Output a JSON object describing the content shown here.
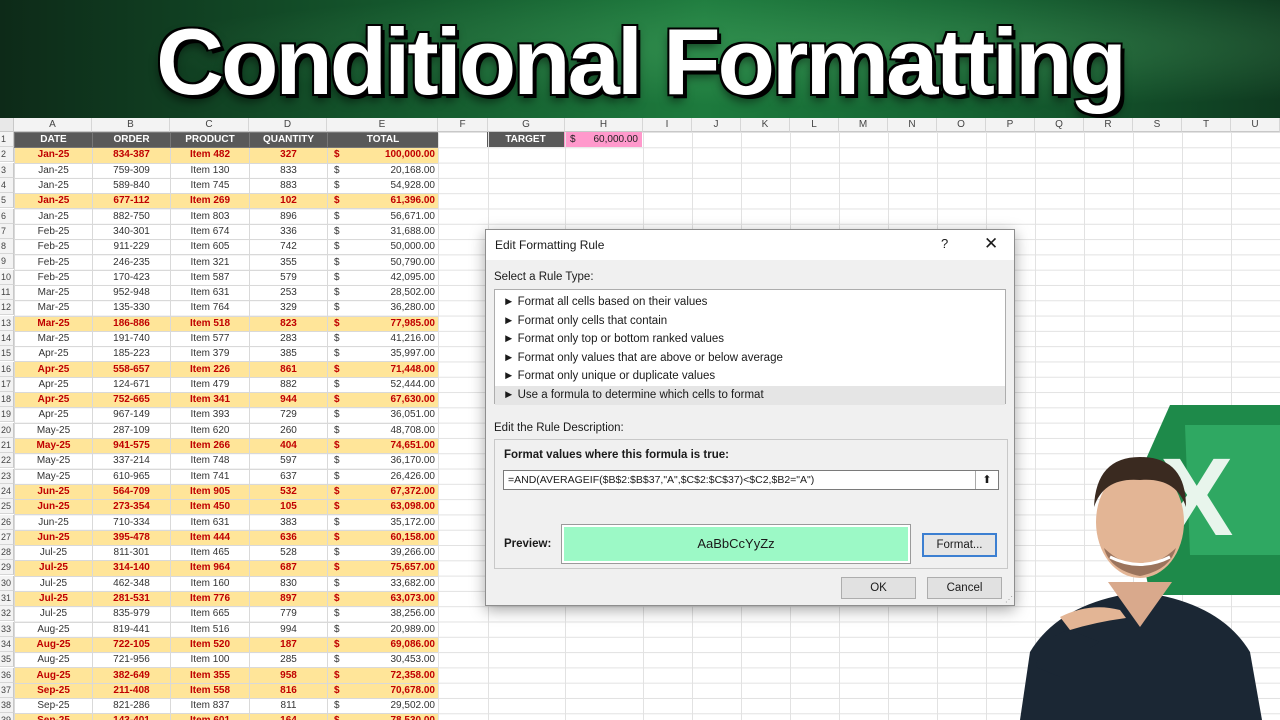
{
  "banner": {
    "title": "Conditional Formatting"
  },
  "columns": [
    "A",
    "B",
    "C",
    "D",
    "E",
    "F",
    "G",
    "H",
    "I",
    "J",
    "K",
    "L",
    "M",
    "N",
    "O",
    "P",
    "Q",
    "R",
    "S",
    "T",
    "U"
  ],
  "table": {
    "headers": [
      "DATE",
      "ORDER",
      "PRODUCT",
      "QUANTITY",
      "TOTAL"
    ],
    "currency": "$",
    "rows": [
      {
        "n": "2",
        "date": "Jan-25",
        "order": "834-387",
        "product": "Item 482",
        "qty": "327",
        "total": "100,000.00",
        "hl": true
      },
      {
        "n": "3",
        "date": "Jan-25",
        "order": "759-309",
        "product": "Item 130",
        "qty": "833",
        "total": "20,168.00",
        "hl": false
      },
      {
        "n": "4",
        "date": "Jan-25",
        "order": "589-840",
        "product": "Item 745",
        "qty": "883",
        "total": "54,928.00",
        "hl": false
      },
      {
        "n": "5",
        "date": "Jan-25",
        "order": "677-112",
        "product": "Item 269",
        "qty": "102",
        "total": "61,396.00",
        "hl": true
      },
      {
        "n": "6",
        "date": "Jan-25",
        "order": "882-750",
        "product": "Item 803",
        "qty": "896",
        "total": "56,671.00",
        "hl": false
      },
      {
        "n": "7",
        "date": "Feb-25",
        "order": "340-301",
        "product": "Item 674",
        "qty": "336",
        "total": "31,688.00",
        "hl": false
      },
      {
        "n": "8",
        "date": "Feb-25",
        "order": "911-229",
        "product": "Item 605",
        "qty": "742",
        "total": "50,000.00",
        "hl": false
      },
      {
        "n": "9",
        "date": "Feb-25",
        "order": "246-235",
        "product": "Item 321",
        "qty": "355",
        "total": "50,790.00",
        "hl": false
      },
      {
        "n": "10",
        "date": "Feb-25",
        "order": "170-423",
        "product": "Item 587",
        "qty": "579",
        "total": "42,095.00",
        "hl": false
      },
      {
        "n": "11",
        "date": "Mar-25",
        "order": "952-948",
        "product": "Item 631",
        "qty": "253",
        "total": "28,502.00",
        "hl": false
      },
      {
        "n": "12",
        "date": "Mar-25",
        "order": "135-330",
        "product": "Item 764",
        "qty": "329",
        "total": "36,280.00",
        "hl": false
      },
      {
        "n": "13",
        "date": "Mar-25",
        "order": "186-886",
        "product": "Item 518",
        "qty": "823",
        "total": "77,985.00",
        "hl": true
      },
      {
        "n": "14",
        "date": "Mar-25",
        "order": "191-740",
        "product": "Item 577",
        "qty": "283",
        "total": "41,216.00",
        "hl": false
      },
      {
        "n": "15",
        "date": "Apr-25",
        "order": "185-223",
        "product": "Item 379",
        "qty": "385",
        "total": "35,997.00",
        "hl": false
      },
      {
        "n": "16",
        "date": "Apr-25",
        "order": "558-657",
        "product": "Item 226",
        "qty": "861",
        "total": "71,448.00",
        "hl": true
      },
      {
        "n": "17",
        "date": "Apr-25",
        "order": "124-671",
        "product": "Item 479",
        "qty": "882",
        "total": "52,444.00",
        "hl": false
      },
      {
        "n": "18",
        "date": "Apr-25",
        "order": "752-665",
        "product": "Item 341",
        "qty": "944",
        "total": "67,630.00",
        "hl": true
      },
      {
        "n": "19",
        "date": "Apr-25",
        "order": "967-149",
        "product": "Item 393",
        "qty": "729",
        "total": "36,051.00",
        "hl": false
      },
      {
        "n": "20",
        "date": "May-25",
        "order": "287-109",
        "product": "Item 620",
        "qty": "260",
        "total": "48,708.00",
        "hl": false
      },
      {
        "n": "21",
        "date": "May-25",
        "order": "941-575",
        "product": "Item 266",
        "qty": "404",
        "total": "74,651.00",
        "hl": true
      },
      {
        "n": "22",
        "date": "May-25",
        "order": "337-214",
        "product": "Item 748",
        "qty": "597",
        "total": "36,170.00",
        "hl": false
      },
      {
        "n": "23",
        "date": "May-25",
        "order": "610-965",
        "product": "Item 741",
        "qty": "637",
        "total": "26,426.00",
        "hl": false
      },
      {
        "n": "24",
        "date": "Jun-25",
        "order": "564-709",
        "product": "Item 905",
        "qty": "532",
        "total": "67,372.00",
        "hl": true
      },
      {
        "n": "25",
        "date": "Jun-25",
        "order": "273-354",
        "product": "Item 450",
        "qty": "105",
        "total": "63,098.00",
        "hl": true
      },
      {
        "n": "26",
        "date": "Jun-25",
        "order": "710-334",
        "product": "Item 631",
        "qty": "383",
        "total": "35,172.00",
        "hl": false
      },
      {
        "n": "27",
        "date": "Jun-25",
        "order": "395-478",
        "product": "Item 444",
        "qty": "636",
        "total": "60,158.00",
        "hl": true
      },
      {
        "n": "28",
        "date": "Jul-25",
        "order": "811-301",
        "product": "Item 465",
        "qty": "528",
        "total": "39,266.00",
        "hl": false
      },
      {
        "n": "29",
        "date": "Jul-25",
        "order": "314-140",
        "product": "Item 964",
        "qty": "687",
        "total": "75,657.00",
        "hl": true
      },
      {
        "n": "30",
        "date": "Jul-25",
        "order": "462-348",
        "product": "Item 160",
        "qty": "830",
        "total": "33,682.00",
        "hl": false
      },
      {
        "n": "31",
        "date": "Jul-25",
        "order": "281-531",
        "product": "Item 776",
        "qty": "897",
        "total": "63,073.00",
        "hl": true
      },
      {
        "n": "32",
        "date": "Jul-25",
        "order": "835-979",
        "product": "Item 665",
        "qty": "779",
        "total": "38,256.00",
        "hl": false
      },
      {
        "n": "33",
        "date": "Aug-25",
        "order": "819-441",
        "product": "Item 516",
        "qty": "994",
        "total": "20,989.00",
        "hl": false
      },
      {
        "n": "34",
        "date": "Aug-25",
        "order": "722-105",
        "product": "Item 520",
        "qty": "187",
        "total": "69,086.00",
        "hl": true
      },
      {
        "n": "35",
        "date": "Aug-25",
        "order": "721-956",
        "product": "Item 100",
        "qty": "285",
        "total": "30,453.00",
        "hl": false
      },
      {
        "n": "36",
        "date": "Aug-25",
        "order": "382-649",
        "product": "Item 355",
        "qty": "958",
        "total": "72,358.00",
        "hl": true
      },
      {
        "n": "37",
        "date": "Sep-25",
        "order": "211-408",
        "product": "Item 558",
        "qty": "816",
        "total": "70,678.00",
        "hl": true
      },
      {
        "n": "38",
        "date": "Sep-25",
        "order": "821-286",
        "product": "Item 837",
        "qty": "811",
        "total": "29,502.00",
        "hl": false
      },
      {
        "n": "39",
        "date": "Sep-25",
        "order": "143-401",
        "product": "Item 601",
        "qty": "164",
        "total": "78,530.00",
        "hl": true
      }
    ]
  },
  "target": {
    "label": "TARGET",
    "currency": "$",
    "value": "60,000.00"
  },
  "dialog": {
    "title": "Edit Formatting Rule",
    "help": "?",
    "close": "✕",
    "select_label": "Select a Rule Type:",
    "rule_types": [
      "► Format all cells based on their values",
      "► Format only cells that contain",
      "► Format only top or bottom ranked values",
      "► Format only values that are above or below average",
      "► Format only unique or duplicate values",
      "► Use a formula to determine which cells to format"
    ],
    "selected_rule_index": 5,
    "edit_label": "Edit the Rule Description:",
    "formula_label": "Format values where this formula is true:",
    "formula": "=AND(AVERAGEIF($B$2:$B$37,\"A\",$C$2:$C$37)<$C2,$B2=\"A\")",
    "preview_label": "Preview:",
    "preview_text": "AaBbCcYyZz",
    "preview_color": "#9cf9c6",
    "format_button": "Format...",
    "ok": "OK",
    "cancel": "Cancel"
  },
  "colors": {
    "header_bg": "#595959",
    "highlight_fill": "#ffe599",
    "highlight_text": "#c00000",
    "target_fill": "#ff99cc"
  }
}
